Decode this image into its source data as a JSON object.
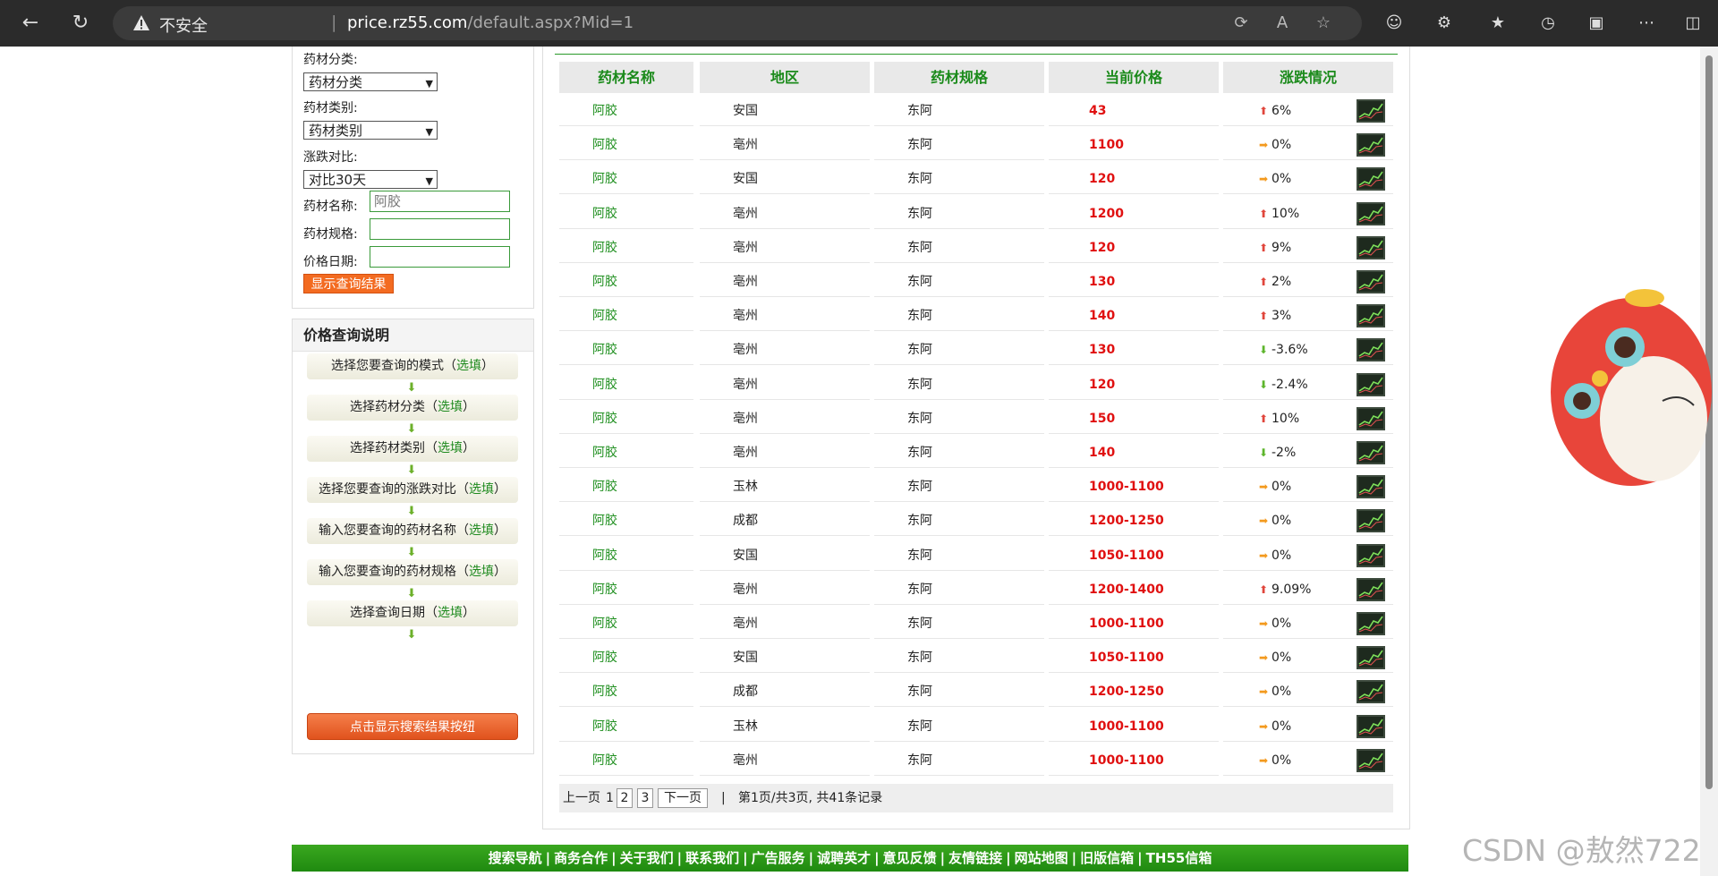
{
  "browser": {
    "insecure_label": "不安全",
    "url_host": "price.rz55.com",
    "url_path": "/default.aspx?Mid=1"
  },
  "filters": {
    "category_label": "药材分类:",
    "category_value": "药材分类",
    "type_label": "药材类别:",
    "type_value": "药材类别",
    "compare_label": "涨跌对比:",
    "compare_value": "对比30天",
    "name_label": "药材名称:",
    "name_placeholder": "阿胶",
    "spec_label": "药材规格:",
    "date_label": "价格日期:",
    "show_button": "显示查询结果"
  },
  "help": {
    "title": "价格查询说明",
    "steps": [
      {
        "text": "选择您要查询的模式（",
        "opt": "选填",
        "end": "）"
      },
      {
        "text": "选择药材分类（",
        "opt": "选填",
        "end": "）"
      },
      {
        "text": "选择药材类别（",
        "opt": "选填",
        "end": "）"
      },
      {
        "text": "选择您要查询的涨跌对比（",
        "opt": "选填",
        "end": "）"
      },
      {
        "text": "输入您要查询的药材名称（",
        "opt": "选填",
        "end": "）"
      },
      {
        "text": "输入您要查询的药材规格（",
        "opt": "选填",
        "end": "）"
      },
      {
        "text": "选择查询日期（",
        "opt": "选填",
        "end": "）"
      }
    ],
    "button": "点击显示搜索结果按纽"
  },
  "table": {
    "headers": [
      "药材名称",
      "地区",
      "药材规格",
      "当前价格",
      "涨跌情况"
    ],
    "rows": [
      {
        "name": "阿胶",
        "area": "安国",
        "spec": "东阿",
        "price": "43",
        "trend": "up",
        "change": "6%"
      },
      {
        "name": "阿胶",
        "area": "亳州",
        "spec": "东阿",
        "price": "1100",
        "trend": "flat",
        "change": "0%"
      },
      {
        "name": "阿胶",
        "area": "安国",
        "spec": "东阿",
        "price": "120",
        "trend": "flat",
        "change": "0%"
      },
      {
        "name": "阿胶",
        "area": "亳州",
        "spec": "东阿",
        "price": "1200",
        "trend": "up",
        "change": "10%"
      },
      {
        "name": "阿胶",
        "area": "亳州",
        "spec": "东阿",
        "price": "120",
        "trend": "up",
        "change": "9%"
      },
      {
        "name": "阿胶",
        "area": "亳州",
        "spec": "东阿",
        "price": "130",
        "trend": "up",
        "change": "2%"
      },
      {
        "name": "阿胶",
        "area": "亳州",
        "spec": "东阿",
        "price": "140",
        "trend": "up",
        "change": "3%"
      },
      {
        "name": "阿胶",
        "area": "亳州",
        "spec": "东阿",
        "price": "130",
        "trend": "down",
        "change": "-3.6%"
      },
      {
        "name": "阿胶",
        "area": "亳州",
        "spec": "东阿",
        "price": "120",
        "trend": "down",
        "change": "-2.4%"
      },
      {
        "name": "阿胶",
        "area": "亳州",
        "spec": "东阿",
        "price": "150",
        "trend": "up",
        "change": "10%"
      },
      {
        "name": "阿胶",
        "area": "亳州",
        "spec": "东阿",
        "price": "140",
        "trend": "down",
        "change": "-2%"
      },
      {
        "name": "阿胶",
        "area": "玉林",
        "spec": "东阿",
        "price": "1000-1100",
        "trend": "flat",
        "change": "0%"
      },
      {
        "name": "阿胶",
        "area": "成都",
        "spec": "东阿",
        "price": "1200-1250",
        "trend": "flat",
        "change": "0%"
      },
      {
        "name": "阿胶",
        "area": "安国",
        "spec": "东阿",
        "price": "1050-1100",
        "trend": "flat",
        "change": "0%"
      },
      {
        "name": "阿胶",
        "area": "亳州",
        "spec": "东阿",
        "price": "1200-1400",
        "trend": "up",
        "change": "9.09%"
      },
      {
        "name": "阿胶",
        "area": "亳州",
        "spec": "东阿",
        "price": "1000-1100",
        "trend": "flat",
        "change": "0%"
      },
      {
        "name": "阿胶",
        "area": "安国",
        "spec": "东阿",
        "price": "1050-1100",
        "trend": "flat",
        "change": "0%"
      },
      {
        "name": "阿胶",
        "area": "成都",
        "spec": "东阿",
        "price": "1200-1250",
        "trend": "flat",
        "change": "0%"
      },
      {
        "name": "阿胶",
        "area": "玉林",
        "spec": "东阿",
        "price": "1000-1100",
        "trend": "flat",
        "change": "0%"
      },
      {
        "name": "阿胶",
        "area": "亳州",
        "spec": "东阿",
        "price": "1000-1100",
        "trend": "flat",
        "change": "0%"
      }
    ]
  },
  "pager": {
    "prev": "上一页",
    "current": "1",
    "page2": "2",
    "page3": "3",
    "next": "下一页",
    "divider": "|",
    "summary": "第1页/共3页, 共41条记录"
  },
  "footer_links": [
    "搜索导航",
    "商务合作",
    "关于我们",
    "联系我们",
    "广告服务",
    "诚聘英才",
    "意见反馈",
    "友情链接",
    "网站地图",
    "旧版信箱",
    "TH55信箱"
  ],
  "watermark": "CSDN @敖然722",
  "colors": {
    "green": "#1f8f1f",
    "price_red": "#e01010",
    "orange": "#f36b21",
    "up": "#e0463c",
    "down": "#5db52c",
    "flat": "#f39a1e"
  }
}
